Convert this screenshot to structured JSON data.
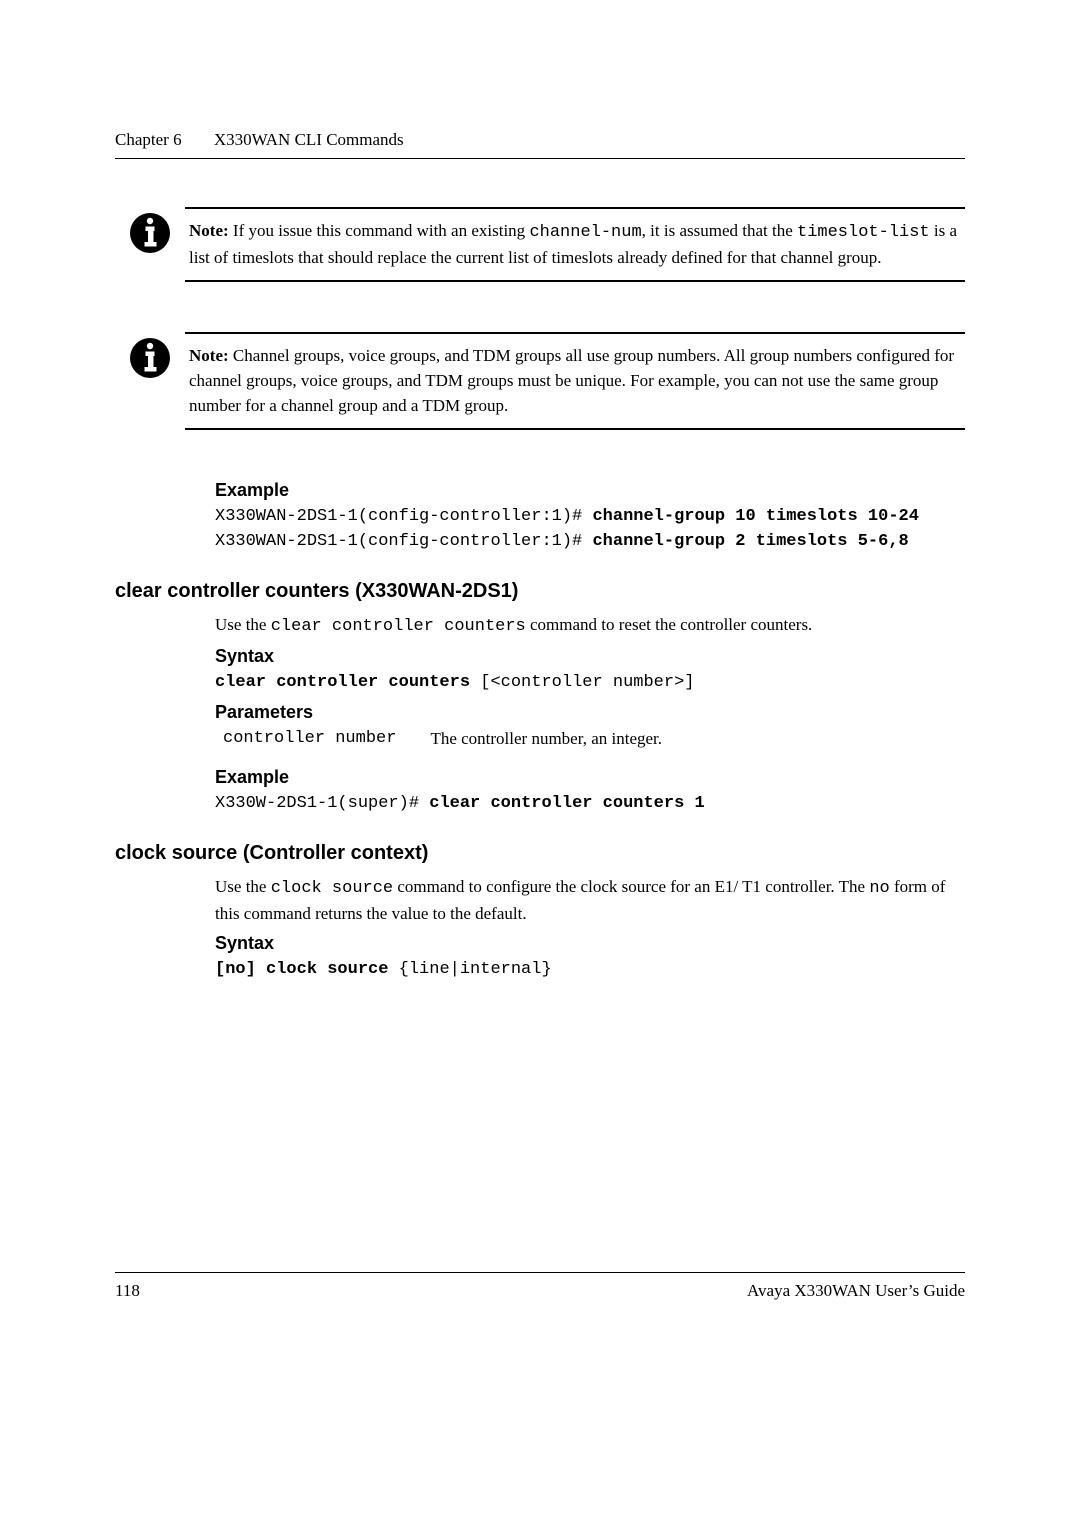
{
  "header": {
    "chapter": "Chapter 6",
    "title": "X330WAN CLI Commands"
  },
  "note1": {
    "label": "Note:",
    "text_pre": "If you issue this command with an existing ",
    "code1": "channel-num",
    "text_mid1": ", it is assumed that the ",
    "code2": "timeslot-list",
    "text_end": " is a list of timeslots that should replace the current list of timeslots already defined for that channel group."
  },
  "note2": {
    "label": "Note:",
    "text": "Channel groups, voice groups, and TDM groups all use group numbers. All group numbers configured for channel groups, voice groups, and TDM groups must be unique. For example, you can not use the same group number for a channel group and a TDM group."
  },
  "example1": {
    "heading": "Example",
    "line1_prompt": "X330WAN-2DS1-1(config-controller:1)# ",
    "line1_bold": "channel-group 10 timeslots 10-24",
    "line2_prompt": "X330WAN-2DS1-1(config-controller:1)# ",
    "line2_bold": "channel-group 2 timeslots 5-6,8"
  },
  "section1": {
    "heading": "clear controller counters (X330WAN-2DS1)",
    "intro_pre": "Use the ",
    "intro_code": "clear controller counters",
    "intro_post": " command to reset the controller counters.",
    "syntax_heading": "Syntax",
    "syntax_bold": "clear controller counters ",
    "syntax_rest": "[<controller number>]",
    "params_heading": "Parameters",
    "param_name": "controller number",
    "param_desc": "The controller number, an integer.",
    "example_heading": "Example",
    "example_prompt": "X330W-2DS1-1(super)# ",
    "example_bold": "clear controller counters 1"
  },
  "section2": {
    "heading": "clock source (Controller context)",
    "intro_pre": "Use the ",
    "intro_code": "clock source",
    "intro_mid": " command to configure the clock source for an E1/ T1 controller. The ",
    "intro_code2": "no",
    "intro_post": " form of this command returns the value to the default.",
    "syntax_heading": "Syntax",
    "syntax_bold": "[no] clock source ",
    "syntax_rest": "{line|internal}"
  },
  "footer": {
    "page": "118",
    "book": "Avaya X330WAN User’s Guide"
  }
}
